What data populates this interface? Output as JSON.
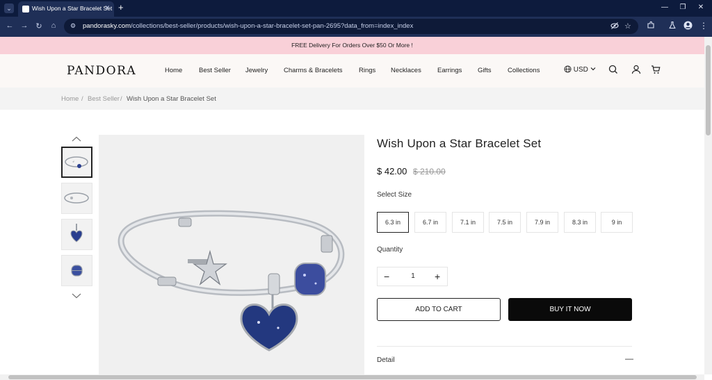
{
  "browser": {
    "tab_title": "Wish Upon a Star Bracelet Set",
    "url_host": "pandorasky.com",
    "url_path": "/collections/best-seller/products/wish-upon-a-star-bracelet-set-pan-2695?data_from=index_index"
  },
  "announcement": "FREE Delivery For Orders Over $50 Or More !",
  "header": {
    "logo": "PANDORA",
    "nav": [
      "Home",
      "Best Seller",
      "Jewelry",
      "Charms & Bracelets",
      "Rings",
      "Necklaces",
      "Earrings",
      "Gifts",
      "Collections"
    ],
    "currency": "USD"
  },
  "breadcrumb": {
    "home": "Home",
    "section": "Best Seller",
    "current": "Wish Upon a Star Bracelet Set",
    "separator": "/"
  },
  "product": {
    "title": "Wish Upon a Star Bracelet Set",
    "price": "$ 42.00",
    "old_price": "$ 210.00",
    "size_label": "Select Size",
    "sizes": [
      "6.3 in",
      "6.7 in",
      "7.1 in",
      "7.5 in",
      "7.9 in",
      "8.3 in",
      "9 in"
    ],
    "selected_size": "6.3 in",
    "quantity_label": "Quantity",
    "quantity": "1",
    "add_to_cart": "ADD TO CART",
    "buy_now": "BUY IT NOW",
    "detail_label": "Detail"
  },
  "colors": {
    "announcement_bg": "#f9d0d8",
    "header_bg": "#fbf8f6",
    "buy_button": "#0a0a0a",
    "chrome_bg": "#1f2f57"
  }
}
